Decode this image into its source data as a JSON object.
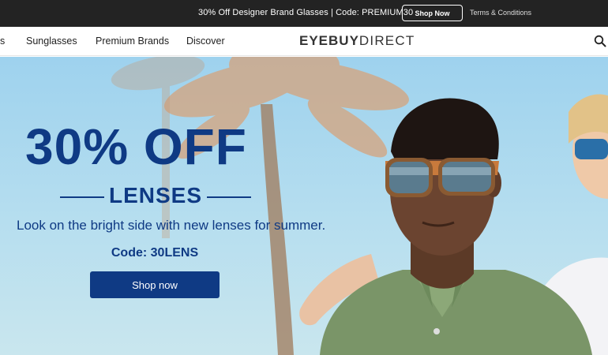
{
  "promo": {
    "text": "30% Off Designer Brand Glasses | Code: PREMIUM30",
    "button_label": "Shop Now",
    "terms_label": "Terms & Conditions"
  },
  "nav": {
    "partial_item": "s",
    "items": [
      "Sunglasses",
      "Premium Brands",
      "Discover"
    ],
    "logo_bold": "EYEBUY",
    "logo_light": "DIRECT",
    "search_icon": "search-icon"
  },
  "hero": {
    "headline": "30% OFF",
    "subhead": "LENSES",
    "tagline": "Look on the bright side with new lenses for summer.",
    "code": "Code: 30LENS",
    "button_label": "Shop now"
  },
  "colors": {
    "brand_blue": "#0f3a84",
    "promo_bg": "#232323",
    "sky": "#a9d8f0"
  }
}
